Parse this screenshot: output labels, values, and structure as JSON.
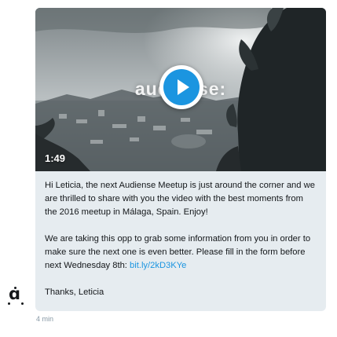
{
  "video": {
    "watermark": "audiense:",
    "duration": "1:49",
    "play_icon": "play-icon",
    "accent_color": "#1b95e0"
  },
  "message": {
    "paragraph1": "Hi Leticia, the next Audiense Meetup is just around the corner and we are thrilled to share with you the video with the best moments from the 2016 meetup in Málaga, Spain. Enjoy!",
    "paragraph2_text": "We are taking this opp to grab some information from you in order to make sure the next one is even better. Please fill in the form before next Wednesday 8th: ",
    "paragraph2_link": "bit.ly/2kD3KYe",
    "signoff": "Thanks, Leticia",
    "link_color": "#1b95e0",
    "bubble_color": "#e6ecf0"
  },
  "sender": {
    "avatar_icon": "audiense-logo-icon"
  },
  "timestamp": "4 min"
}
